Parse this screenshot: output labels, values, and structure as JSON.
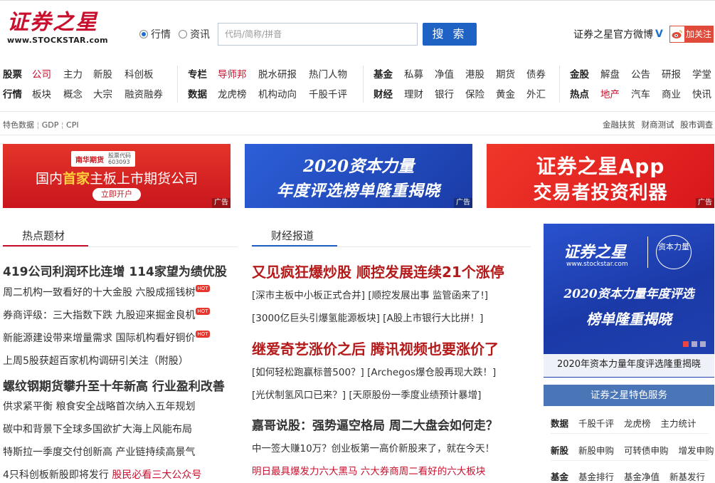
{
  "logo": {
    "cn": "证券之星",
    "en": "www.STOCKSTAR.com"
  },
  "search": {
    "radio1": "行情",
    "radio2": "资讯",
    "placeholder": "代码/简称/拼音",
    "button": "搜 索"
  },
  "weibo": {
    "label": "证券之星官方微博",
    "follow": "加关注"
  },
  "nav": {
    "group1_row1": [
      "股票",
      "公司",
      "主力",
      "新股",
      "科创板"
    ],
    "group1_row2": [
      "行情",
      "板块",
      "概念",
      "大宗",
      "融资融券"
    ],
    "group2_row1": [
      "专栏",
      "导师邦",
      "脱水研报",
      "热门人物"
    ],
    "group2_row2": [
      "数据",
      "龙虎榜",
      "机构动向",
      "千股千评"
    ],
    "group3_row1": [
      "基金",
      "私募",
      "净值",
      "港股",
      "期货",
      "债券"
    ],
    "group3_row2": [
      "财经",
      "理财",
      "银行",
      "保险",
      "黄金",
      "外汇"
    ],
    "group4_row1": [
      "金股",
      "解盘",
      "公告",
      "研报",
      "学堂"
    ],
    "group4_row2": [
      "热点",
      "地产",
      "汽车",
      "商业",
      "快讯"
    ]
  },
  "special": {
    "left": [
      "特色数据",
      "GDP",
      "CPI"
    ],
    "right": "金融扶贫 财商测试 股市调查"
  },
  "banners": {
    "b1": {
      "logo": "南华期货",
      "code_label": "股票代码",
      "code": "603093",
      "line1_a": "国内",
      "line1_b": "首家",
      "line1_c": "主板上市期货公司",
      "cta": "立即开户",
      "ad": "广告"
    },
    "b2": {
      "line1": "2020资本力量",
      "line2": "年度评选榜单隆重揭晓",
      "ad": "广告"
    },
    "b3": {
      "line1": "证券之星App",
      "line2": "交易者投资利器",
      "ad": "广告"
    }
  },
  "hot_topics": {
    "tab": "热点题材",
    "headline1": "419公司利润环比连增 114家望为绩优股",
    "items1": [
      {
        "text": "周二机构一致看好的十大金股 六股成摇钱树",
        "hot": "HOT"
      },
      {
        "text": "券商评级：三大指数下跌 九股迎来掘金良机",
        "hot": "HOT"
      },
      {
        "text": "新能源建设带来增量需求 国际机构看好铜价",
        "hot": "HOT"
      },
      {
        "text": "上周5股获超百家机构调研引关注（附股）",
        "hot": ""
      }
    ],
    "headline2": "螺纹钢期货攀升至十年新高 行业盈利改善",
    "items2": [
      "供求紧平衡 粮食安全战略首次纳入五年规划",
      "碳中和背景下全球多国欲扩大海上风能布局",
      "特斯拉一季度交付创新高 产业链持续高景气"
    ],
    "last_a": "4只科创板新股即将发行",
    "last_b": "股民必看三大公众号"
  },
  "finance_news": {
    "tab": "财经报道",
    "headline1": "又见疯狂爆炒股 顺控发展连续21个涨停",
    "links1a": "[深市主板中小板正式合并] [顺控发展出事 监管函来了!]",
    "links1b": "[3000亿巨头引爆氢能源板块] [A股上市银行大比拼！]",
    "headline2": "继爱奇艺涨价之后 腾讯视频也要涨价了",
    "links2a": "[如何轻松跑赢标普500？] [Archegos爆仓股再现大跌！]",
    "links2b": "[光伏制氢风口已来？] [天原股份一季度业绩预计暴增]",
    "headline3": "嘉哥说股：强势逼空格局 周二大盘会如何走？",
    "line3": "中一签大赚10万？创业板第一高价新股来了，就在今天！",
    "line4": "明日最具爆发力六大黑马 六大券商周二看好的六大板块"
  },
  "side": {
    "banner_brand": "证券之星",
    "banner_url": "www.stockstar.com",
    "banner_badge": "资本力量",
    "banner_line1": "2020资本力量年度评选",
    "banner_line2": "榜单隆重揭晓",
    "caption": "2020年资本力量年度评选隆重揭晓",
    "service_head": "证券之星特色服务",
    "rows": [
      {
        "label": "数据",
        "items": [
          "千股千评",
          "龙虎榜",
          "主力统计"
        ]
      },
      {
        "label": "新股",
        "items": [
          "新股申购",
          "可转债申购",
          "增发申购"
        ]
      },
      {
        "label": "基金",
        "items": [
          "基金排行",
          "基金净值",
          "新基发行"
        ]
      }
    ]
  },
  "colors": {
    "brand_red": "#c8102e",
    "blue": "#1e62c4",
    "headline_red": "#b51a1a"
  }
}
